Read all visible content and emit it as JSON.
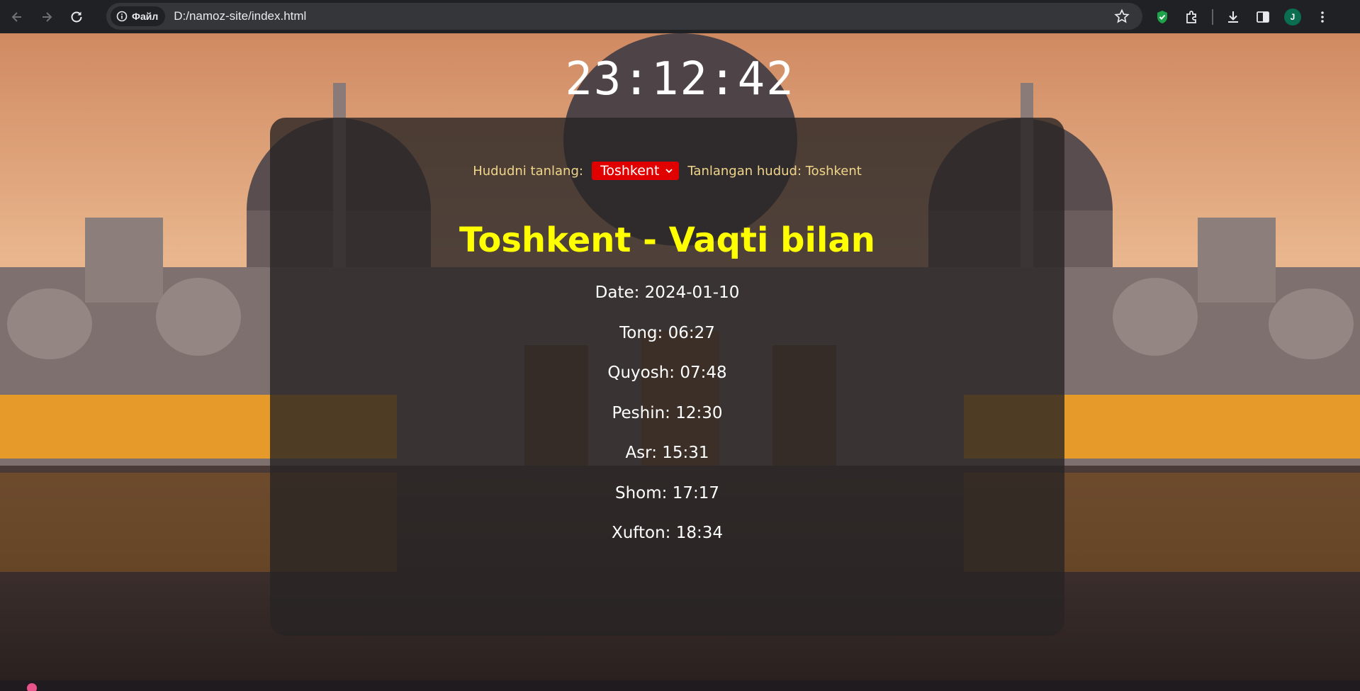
{
  "browser": {
    "site_chip_label": "Файл",
    "url": "D:/namoz-site/index.html",
    "profile_initial": "J"
  },
  "page": {
    "clock": "23:12:42",
    "region_label": "Hududni tanlang:",
    "region_selected": "Toshkent",
    "selected_region_text": "Tanlangan hudud: Toshkent",
    "heading": "Toshkent - Vaqti bilan",
    "times": [
      "Date: 2024-01-10",
      "Tong: 06:27",
      "Quyosh: 07:48",
      "Peshin: 12:30",
      "Asr: 15:31",
      "Shom: 17:17",
      "Xufton: 18:34"
    ]
  },
  "colors": {
    "heading": "#ffff00",
    "select_bg": "#e00000",
    "label": "#f0d68a"
  }
}
